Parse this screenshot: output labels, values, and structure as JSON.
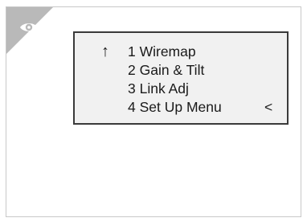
{
  "icons": {
    "corner_icon": "eye-icon"
  },
  "colors": {
    "corner_tab": "#b9b9b9",
    "screen_background": "#f1f1f1",
    "screen_border": "#3a3a3a",
    "text": "#1a1a1a"
  },
  "display": {
    "menu": [
      {
        "prefix": "↑",
        "label": "1 Wiremap",
        "suffix": ""
      },
      {
        "prefix": "",
        "label": "2 Gain & Tilt",
        "suffix": ""
      },
      {
        "prefix": "",
        "label": "3 Link Adj",
        "suffix": ""
      },
      {
        "prefix": "",
        "label": "4 Set Up Menu",
        "suffix": "<"
      }
    ]
  }
}
